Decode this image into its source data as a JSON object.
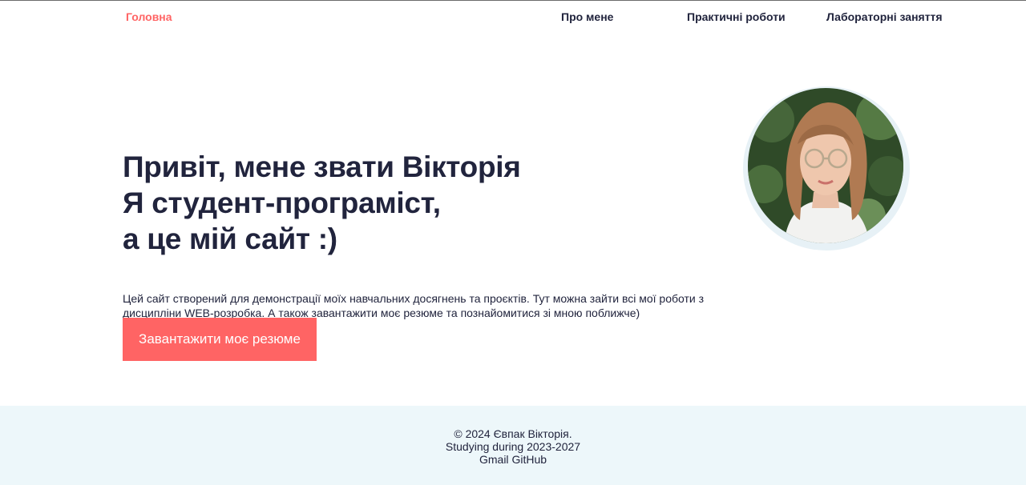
{
  "nav": {
    "home": "Головна",
    "about": "Про мене",
    "practice": "Практичні роботи",
    "labs": "Лабораторні заняття"
  },
  "hero": {
    "line1": "Привіт, мене звати Вікторія",
    "line2": "Я студент-програміст,",
    "line3": "а це мій сайт :)",
    "description": "Цей сайт створений для демонстрації моїх навчальних досягнень та проєктів. Тут можна зайти всі мої роботи з дисципліни WEB-розробка. А також завантажити моє резюме та познайомитися зі мною поближче)",
    "button": "Завантажити моє резюме"
  },
  "footer": {
    "copyright": "© 2024 Євпак Вікторія.",
    "studying": "Studying during 2023-2027",
    "gmail": "Gmail",
    "github": "GitHub"
  },
  "colors": {
    "accent": "#ff6464",
    "text": "#21243d",
    "footer_bg": "#edf7fa"
  }
}
